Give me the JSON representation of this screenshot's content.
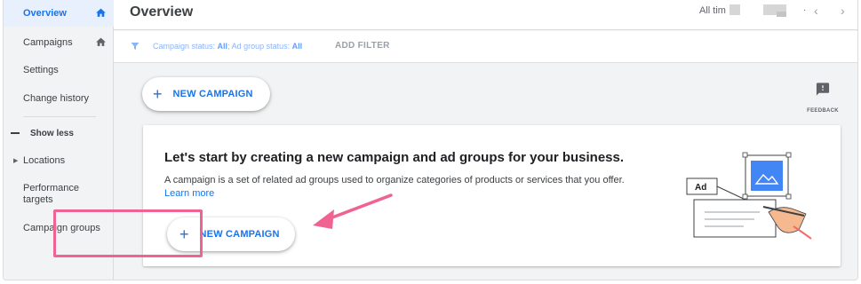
{
  "sidebar": {
    "items": [
      {
        "label": "Overview",
        "active": true,
        "icon": "home-icon"
      },
      {
        "label": "Campaigns",
        "active": false,
        "icon": "home-icon"
      },
      {
        "label": "Settings"
      },
      {
        "label": "Change history"
      },
      {
        "label": "Show less"
      },
      {
        "label": "Locations"
      },
      {
        "label": "Performance targets"
      },
      {
        "label": "Campaign groups"
      }
    ]
  },
  "header": {
    "title": "Overview",
    "date_range": "All tim"
  },
  "filter": {
    "text_prefix": "Campaign status: ",
    "campaign_status": "All",
    "text_mid": "; Ad group status: ",
    "ad_group_status": "All",
    "add_filter_label": "ADD FILTER"
  },
  "toolbar": {
    "new_campaign_label": "NEW CAMPAIGN",
    "feedback_label": "FEEDBACK"
  },
  "card": {
    "title": "Let's start by creating a new campaign and ad groups for your business.",
    "description": "A campaign is a set of related ad groups used to organize categories of products or services that you offer.",
    "learn_more": "Learn more",
    "button_label": "NEW CAMPAIGN",
    "illustration_ad_label": "Ad"
  },
  "colors": {
    "accent": "#1a73e8",
    "highlight": "#f06292",
    "active_bg": "#e8f0fe"
  }
}
